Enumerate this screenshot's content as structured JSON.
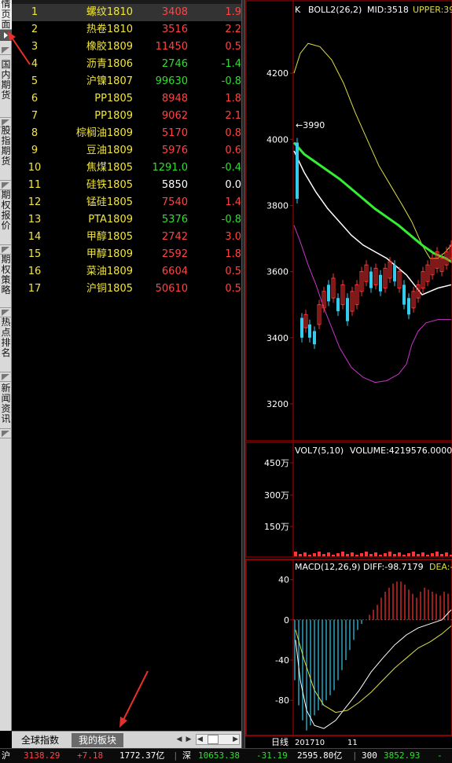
{
  "sidebar": {
    "tabs": [
      {
        "label": "行情页面",
        "active": true
      },
      {
        "label": "国内期货",
        "active": false
      },
      {
        "label": "股指期货",
        "active": false
      },
      {
        "label": "期权报价",
        "active": false
      },
      {
        "label": "期权策略",
        "active": false
      },
      {
        "label": "热点排名",
        "active": false
      },
      {
        "label": "新闻资讯",
        "active": false
      }
    ]
  },
  "quote_list": {
    "rows": [
      {
        "no": "1",
        "name": "螺纹1810",
        "price": "3408",
        "change": "1.9",
        "name_color": "#f2e640",
        "price_color": "#ff4444",
        "change_color": "#ff4444"
      },
      {
        "no": "2",
        "name": "热卷1810",
        "price": "3516",
        "change": "2.2",
        "name_color": "#f2e640",
        "price_color": "#ff4444",
        "change_color": "#ff4444"
      },
      {
        "no": "3",
        "name": "橡胶1809",
        "price": "11450",
        "change": "0.5",
        "name_color": "#f2e640",
        "price_color": "#ff4444",
        "change_color": "#ff4444"
      },
      {
        "no": "4",
        "name": "沥青1806",
        "price": "2746",
        "change": "-1.4",
        "name_color": "#f2e640",
        "price_color": "#33dd33",
        "change_color": "#33dd33"
      },
      {
        "no": "5",
        "name": "沪镍1807",
        "price": "99630",
        "change": "-0.8",
        "name_color": "#f2e640",
        "price_color": "#33dd33",
        "change_color": "#33dd33"
      },
      {
        "no": "6",
        "name": "PP1805",
        "price": "8948",
        "change": "1.8",
        "name_color": "#f2e640",
        "price_color": "#ff4444",
        "change_color": "#ff4444"
      },
      {
        "no": "7",
        "name": "PP1809",
        "price": "9062",
        "change": "2.1",
        "name_color": "#f2e640",
        "price_color": "#ff4444",
        "change_color": "#ff4444"
      },
      {
        "no": "8",
        "name": "棕榈油1809",
        "price": "5170",
        "change": "0.8",
        "name_color": "#f2e640",
        "price_color": "#ff4444",
        "change_color": "#ff4444"
      },
      {
        "no": "9",
        "name": "豆油1809",
        "price": "5976",
        "change": "0.6",
        "name_color": "#f2e640",
        "price_color": "#ff4444",
        "change_color": "#ff4444"
      },
      {
        "no": "10",
        "name": "焦煤1805",
        "price": "1291.0",
        "change": "-0.4",
        "name_color": "#f2e640",
        "price_color": "#33dd33",
        "change_color": "#33dd33"
      },
      {
        "no": "11",
        "name": "硅铁1805",
        "price": "5850",
        "change": "0.0",
        "name_color": "#f2e640",
        "price_color": "#ffffff",
        "change_color": "#ffffff"
      },
      {
        "no": "12",
        "name": "锰硅1805",
        "price": "7540",
        "change": "1.4",
        "name_color": "#f2e640",
        "price_color": "#ff4444",
        "change_color": "#ff4444"
      },
      {
        "no": "13",
        "name": "PTA1809",
        "price": "5376",
        "change": "-0.8",
        "name_color": "#f2e640",
        "price_color": "#33dd33",
        "change_color": "#33dd33"
      },
      {
        "no": "14",
        "name": "甲醇1805",
        "price": "2742",
        "change": "3.0",
        "name_color": "#f2e640",
        "price_color": "#ff4444",
        "change_color": "#ff4444"
      },
      {
        "no": "15",
        "name": "甲醇1809",
        "price": "2592",
        "change": "1.8",
        "name_color": "#f2e640",
        "price_color": "#ff4444",
        "change_color": "#ff4444"
      },
      {
        "no": "16",
        "name": "菜油1809",
        "price": "6604",
        "change": "0.5",
        "name_color": "#f2e640",
        "price_color": "#ff4444",
        "change_color": "#ff4444"
      },
      {
        "no": "17",
        "name": "沪铜1805",
        "price": "50610",
        "change": "0.5",
        "name_color": "#f2e640",
        "price_color": "#ff4444",
        "change_color": "#ff4444"
      }
    ],
    "tabs": {
      "global": "全球指数",
      "mine": "我的板块"
    }
  },
  "chart_data": [
    {
      "type": "candlestick",
      "title": "K",
      "indicator": "BOLL2(26,2)",
      "mid_label": "MID:3518",
      "upper_label": "UPPER:39",
      "y_ticks": [
        "4200",
        "4000",
        "3800",
        "3600",
        "3400",
        "3200"
      ],
      "ylim": [
        3100,
        4350
      ],
      "high_marker": "3990",
      "colors": {
        "up": "#ff3333",
        "down": "#33ccee",
        "mid": "#ffffff",
        "upper": "#dddd44",
        "lower": "#cc33cc",
        "ma": "#33ee33"
      }
    },
    {
      "type": "bar",
      "title": "VOL7(5,10)",
      "value_label": "VOLUME:4219576.0000",
      "y_ticks": [
        "450万",
        "300万",
        "150万"
      ]
    },
    {
      "type": "bar",
      "title": "MACD(12,26,9)",
      "diff_label": "DIFF:-98.7179",
      "dea_label": "DEA:-",
      "y_ticks": [
        "40",
        "0",
        "-40",
        "-80"
      ],
      "ylim": [
        -115,
        60
      ]
    }
  ],
  "chart_footer": {
    "period": "日线",
    "date_start": "201710",
    "date_mid": "11"
  },
  "status_bar": {
    "sh_label": "沪",
    "sh_index": "3138.29",
    "sh_change": "+7.18",
    "sh_amount": "1772.37亿",
    "sz_label": "深",
    "sz_index": "10653.38",
    "sz_change": "-31.19",
    "sz_amount": "2595.80亿",
    "idx300_label": "300",
    "idx300_value": "3852.93",
    "idx300_change": "-"
  },
  "colors": {
    "red": "#ff4444",
    "green": "#33dd33",
    "yellow": "#f2e640",
    "arrow": "#e8302a"
  }
}
